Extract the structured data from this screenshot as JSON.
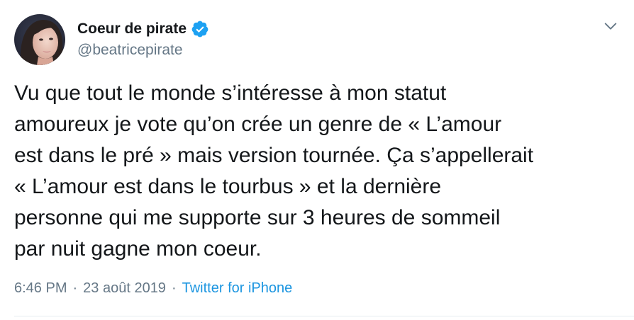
{
  "author": {
    "display_name": "Coeur de pirate",
    "handle": "@beatricepirate",
    "verified": true,
    "avatar_icon": "profile-photo"
  },
  "tweet": {
    "text": "Vu que tout le monde s’intéresse à mon statut\namoureux je vote qu’on crée un genre de « L’amour\nest dans le pré » mais version tournée. Ça s’appellerait\n« L’amour est dans le tourbus » et la dernière\npersonne qui me supporte sur 3 heures de sommeil\npar nuit gagne mon coeur.",
    "time": "6:46 PM",
    "date": "23 août 2019",
    "separator": "·",
    "source": "Twitter for iPhone"
  },
  "colors": {
    "text": "#14171a",
    "secondary": "#657786",
    "link": "#1b95e0",
    "verified": "#1da1f2"
  },
  "icons": {
    "verified": "verified-badge-icon",
    "menu": "chevron-down-icon"
  }
}
